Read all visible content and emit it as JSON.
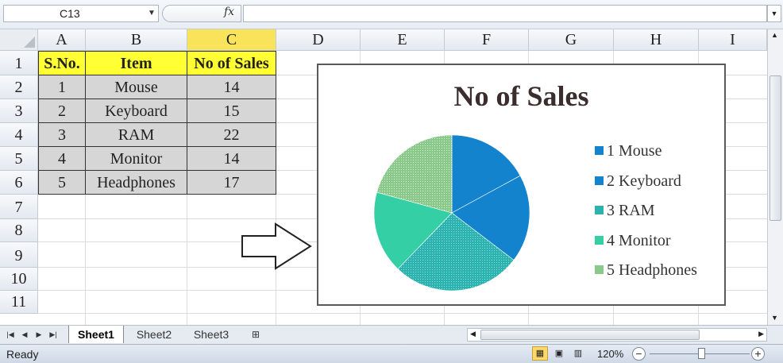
{
  "formula_bar": {
    "name_box": "C13",
    "fx": "fx",
    "formula": ""
  },
  "columns": [
    "A",
    "B",
    "C",
    "D",
    "E",
    "F",
    "G",
    "H",
    "I"
  ],
  "selected_column": "C",
  "rows": [
    "1",
    "2",
    "3",
    "4",
    "5",
    "6",
    "7",
    "8",
    "9",
    "10",
    "11"
  ],
  "table": {
    "headers": [
      "S.No.",
      "Item",
      "No of Sales"
    ],
    "rows": [
      [
        "1",
        "Mouse",
        "14"
      ],
      [
        "2",
        "Keyboard",
        "15"
      ],
      [
        "3",
        "RAM",
        "22"
      ],
      [
        "4",
        "Monitor",
        "14"
      ],
      [
        "5",
        "Headphones",
        "17"
      ]
    ],
    "header_color": "#ffff33",
    "data_color": "#d6d6d6"
  },
  "chart_data": {
    "type": "pie",
    "title": "No of Sales",
    "categories": [
      "1 Mouse",
      "2 Keyboard",
      "3 RAM",
      "4 Monitor",
      "5 Headphones"
    ],
    "values": [
      14,
      15,
      22,
      14,
      17
    ],
    "colors": [
      "#1283cc",
      "#1283cc",
      "#2cb3b0",
      "#35cfa6",
      "#8bc98a"
    ],
    "legend_placement": "right"
  },
  "sheet_tabs": {
    "tabs": [
      "Sheet1",
      "Sheet2",
      "Sheet3"
    ],
    "active": "Sheet1"
  },
  "status_bar": {
    "status": "Ready",
    "zoom": "120%",
    "zoom_out": "−",
    "zoom_in": "+"
  }
}
